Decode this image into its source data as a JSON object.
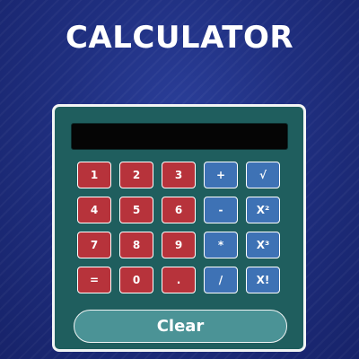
{
  "app": {
    "title": "CALCULATOR"
  },
  "display": {
    "value": ""
  },
  "keypad": {
    "rows": [
      [
        {
          "label": "1",
          "name": "key-1",
          "style": "red"
        },
        {
          "label": "2",
          "name": "key-2",
          "style": "red"
        },
        {
          "label": "3",
          "name": "key-3",
          "style": "red"
        },
        {
          "label": "+",
          "name": "key-plus",
          "style": "blue"
        },
        {
          "label": "√",
          "name": "key-sqrt",
          "style": "blue"
        }
      ],
      [
        {
          "label": "4",
          "name": "key-4",
          "style": "red"
        },
        {
          "label": "5",
          "name": "key-5",
          "style": "red"
        },
        {
          "label": "6",
          "name": "key-6",
          "style": "red"
        },
        {
          "label": "-",
          "name": "key-minus",
          "style": "blue"
        },
        {
          "label": "X²",
          "name": "key-square",
          "style": "blue"
        }
      ],
      [
        {
          "label": "7",
          "name": "key-7",
          "style": "red"
        },
        {
          "label": "8",
          "name": "key-8",
          "style": "red"
        },
        {
          "label": "9",
          "name": "key-9",
          "style": "red"
        },
        {
          "label": "*",
          "name": "key-multiply",
          "style": "blue"
        },
        {
          "label": "X³",
          "name": "key-cube",
          "style": "blue"
        }
      ],
      [
        {
          "label": "=",
          "name": "key-equals",
          "style": "red"
        },
        {
          "label": "0",
          "name": "key-0",
          "style": "red"
        },
        {
          "label": ".",
          "name": "key-decimal",
          "style": "red"
        },
        {
          "label": "/",
          "name": "key-divide",
          "style": "blue"
        },
        {
          "label": "X!",
          "name": "key-factorial",
          "style": "blue"
        }
      ]
    ]
  },
  "clear": {
    "label": "Clear"
  },
  "colors": {
    "background": "#1f2f80",
    "panel": "#1f5e5e",
    "digit_key": "#b7333b",
    "operator_key": "#3e72b5",
    "clear_button": "#4b9396",
    "display": "#050505"
  }
}
